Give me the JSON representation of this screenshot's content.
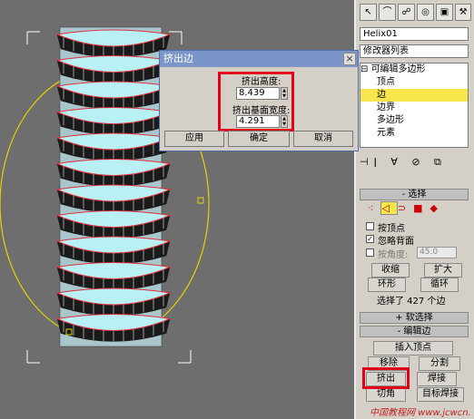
{
  "viewport": {
    "name": "perspective viewport"
  },
  "dialog": {
    "title": "挤出边",
    "height_label": "挤出高度:",
    "height_value": "8.439",
    "width_label": "挤出基面宽度:",
    "width_value": "4.291",
    "apply_label": "应用",
    "ok_label": "确定",
    "cancel_label": "取消"
  },
  "panel": {
    "object_name": "Helix01",
    "modifier_list": "修改器列表",
    "stack": {
      "root": "可编辑多边形",
      "items": [
        "顶点",
        "边",
        "边界",
        "多边形",
        "元素"
      ],
      "selected": "边"
    },
    "selection": {
      "title": "选择",
      "by_vertex": "按顶点",
      "ignore_backfacing": "忽略背面",
      "by_angle": "按角度:",
      "angle_value": "45.0",
      "shrink": "收缩",
      "grow": "扩大",
      "ring": "环形",
      "loop": "循环",
      "status": "选择了 427 个边"
    },
    "soft_selection": {
      "title": "软选择"
    },
    "edit_edges": {
      "title": "编辑边",
      "insert_vertex": "插入顶点",
      "remove": "移除",
      "split": "分割",
      "extrude": "挤出",
      "weld": "焊接",
      "chamfer": "切角",
      "target_weld": "目标焊接"
    }
  },
  "watermark": "中国教程网 www.jcwcn.com",
  "colors": {
    "selected_row": "#f7e64b",
    "highlight_box": "#e0001a",
    "dialog_title": "#7b95c9",
    "mesh_face": "#b8f0f4"
  }
}
